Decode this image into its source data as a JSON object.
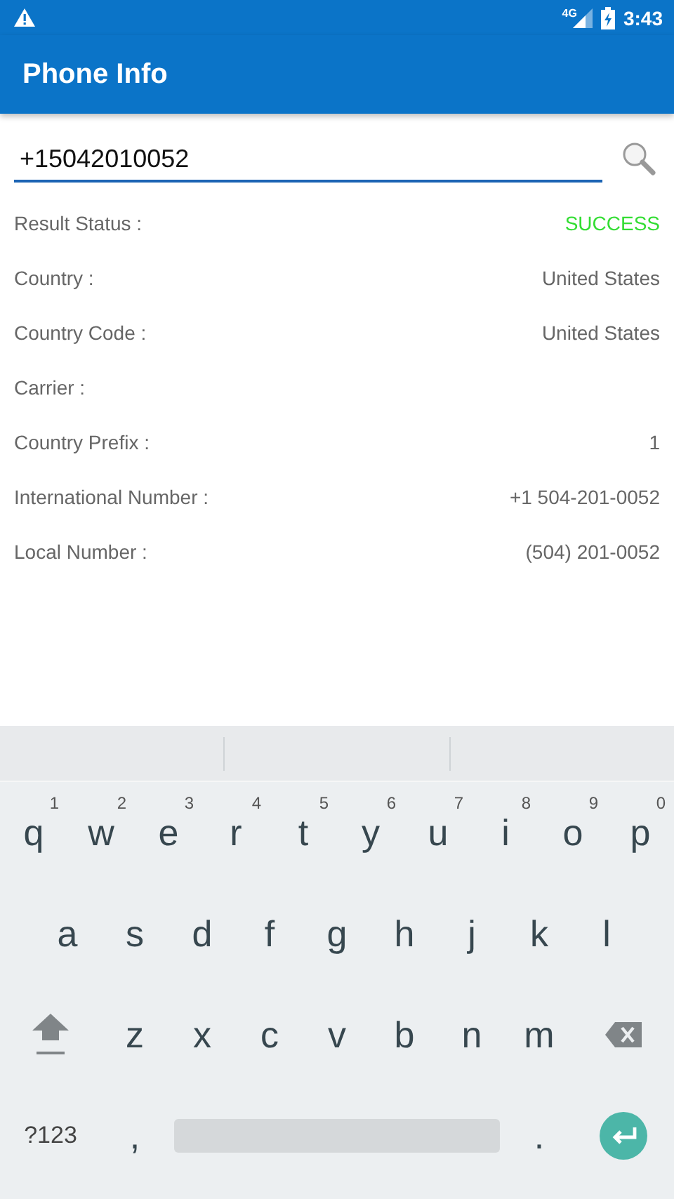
{
  "status_bar": {
    "network": "4G",
    "time": "3:43"
  },
  "app_bar": {
    "title": "Phone Info"
  },
  "search": {
    "value": "+15042010052"
  },
  "results": [
    {
      "label": "Result Status :",
      "value": "SUCCESS",
      "kind": "status"
    },
    {
      "label": "Country :",
      "value": "United States",
      "kind": "text"
    },
    {
      "label": "Country Code :",
      "value": "United States",
      "kind": "text"
    },
    {
      "label": "Carrier :",
      "kind": "text"
    },
    {
      "label": "Country Prefix :",
      "value": "1",
      "kind": "text"
    },
    {
      "label": "International Number :",
      "value": "+1 504-201-0052",
      "kind": "text"
    },
    {
      "label": "Local Number :",
      "value": "(504) 201-0052",
      "kind": "text"
    }
  ],
  "keyboard": {
    "rows": [
      {
        "keys": [
          {
            "kind": "letter",
            "label": "q",
            "hint": "1"
          },
          {
            "kind": "letter",
            "label": "w",
            "hint": "2"
          },
          {
            "kind": "letter",
            "label": "e",
            "hint": "3"
          },
          {
            "kind": "letter",
            "label": "r",
            "hint": "4"
          },
          {
            "kind": "letter",
            "label": "t",
            "hint": "5"
          },
          {
            "kind": "letter",
            "label": "y",
            "hint": "6"
          },
          {
            "kind": "letter",
            "label": "u",
            "hint": "7"
          },
          {
            "kind": "letter",
            "label": "i",
            "hint": "8"
          },
          {
            "kind": "letter",
            "label": "o",
            "hint": "9"
          },
          {
            "kind": "letter",
            "label": "p",
            "hint": "0"
          }
        ]
      },
      {
        "keys": [
          {
            "kind": "letter",
            "label": "a"
          },
          {
            "kind": "letter",
            "label": "s"
          },
          {
            "kind": "letter",
            "label": "d"
          },
          {
            "kind": "letter",
            "label": "f"
          },
          {
            "kind": "letter",
            "label": "g"
          },
          {
            "kind": "letter",
            "label": "h"
          },
          {
            "kind": "letter",
            "label": "j"
          },
          {
            "kind": "letter",
            "label": "k"
          },
          {
            "kind": "letter",
            "label": "l"
          }
        ]
      },
      {
        "keys": [
          {
            "kind": "shift"
          },
          {
            "kind": "letter",
            "label": "z"
          },
          {
            "kind": "letter",
            "label": "x"
          },
          {
            "kind": "letter",
            "label": "c"
          },
          {
            "kind": "letter",
            "label": "v"
          },
          {
            "kind": "letter",
            "label": "b"
          },
          {
            "kind": "letter",
            "label": "n"
          },
          {
            "kind": "letter",
            "label": "m"
          },
          {
            "kind": "backspace"
          }
        ]
      },
      {
        "keys": [
          {
            "kind": "symbols",
            "label": "?123"
          },
          {
            "kind": "punct",
            "label": ","
          },
          {
            "kind": "space"
          },
          {
            "kind": "punct",
            "label": "."
          },
          {
            "kind": "enter"
          }
        ]
      }
    ]
  }
}
